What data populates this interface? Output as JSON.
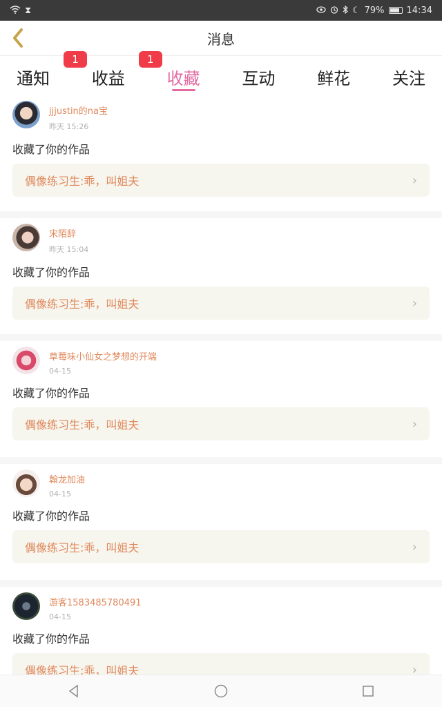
{
  "status": {
    "battery": "79%",
    "time": "14:34",
    "icons": [
      "wifi-icon",
      "hourglass-icon",
      "eye-icon",
      "alarm-icon",
      "bluetooth-icon",
      "moon-icon",
      "battery-icon"
    ]
  },
  "header": {
    "title": "消息",
    "back_icon": "chevron-left-icon"
  },
  "tabs": [
    {
      "label": "通知",
      "badge": "1",
      "active": false
    },
    {
      "label": "收益",
      "badge": "1",
      "active": false
    },
    {
      "label": "收藏",
      "active": true
    },
    {
      "label": "互动",
      "active": false
    },
    {
      "label": "鲜花",
      "active": false
    },
    {
      "label": "关注",
      "active": false
    }
  ],
  "colors": {
    "accent": "#e46aa2",
    "badge": "#f03b48",
    "name": "#e0885b",
    "card_bg": "#f6f6ef"
  },
  "feed": [
    {
      "name": "jjjustin的na宝",
      "time": "昨天 15:26",
      "action": "收藏了你的作品",
      "work": "偶像练习生:乖，叫姐夫"
    },
    {
      "name": "宋陌辞",
      "time": "昨天 15:04",
      "action": "收藏了你的作品",
      "work": "偶像练习生:乖，叫姐夫"
    },
    {
      "name": "草莓味小仙女之梦想的开端",
      "time": "04-15",
      "action": "收藏了你的作品",
      "work": "偶像练习生:乖，叫姐夫"
    },
    {
      "name": "翰龙加油",
      "time": "04-15",
      "action": "收藏了你的作品",
      "work": "偶像练习生:乖，叫姐夫"
    },
    {
      "name": "游客1583485780491",
      "time": "04-15",
      "action": "收藏了你的作品",
      "work": "偶像练习生:乖，叫姐夫"
    }
  ],
  "nav": {
    "back": "back-triangle-icon",
    "home": "home-circle-icon",
    "recents": "recents-square-icon"
  }
}
